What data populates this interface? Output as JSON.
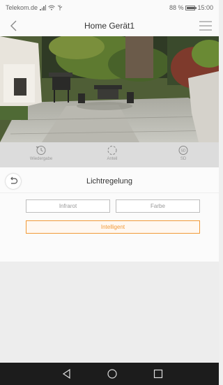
{
  "status_bar": {
    "carrier": "Telekom.de",
    "battery_percent_text": "88 %",
    "battery_level": 0.88,
    "time": "15:00"
  },
  "header": {
    "title": "Home Gerät1",
    "back_icon": "chevron-left-icon",
    "menu_icon": "hamburger-menu-icon"
  },
  "modes": [
    {
      "label": "Wiedergabe",
      "icon": "playback-history-icon"
    },
    {
      "label": "Anteil",
      "icon": "share-icon"
    },
    {
      "label": "SD",
      "icon": "sd-card-icon"
    }
  ],
  "light_panel": {
    "title": "Lichtregelung",
    "options": {
      "infrared": "Infrarot",
      "color": "Farbe",
      "intelligent": "Intelligent"
    },
    "selected": "Intelligent"
  },
  "colors": {
    "accent": "#f29a38",
    "nav_bar": "#1c1c1c"
  }
}
